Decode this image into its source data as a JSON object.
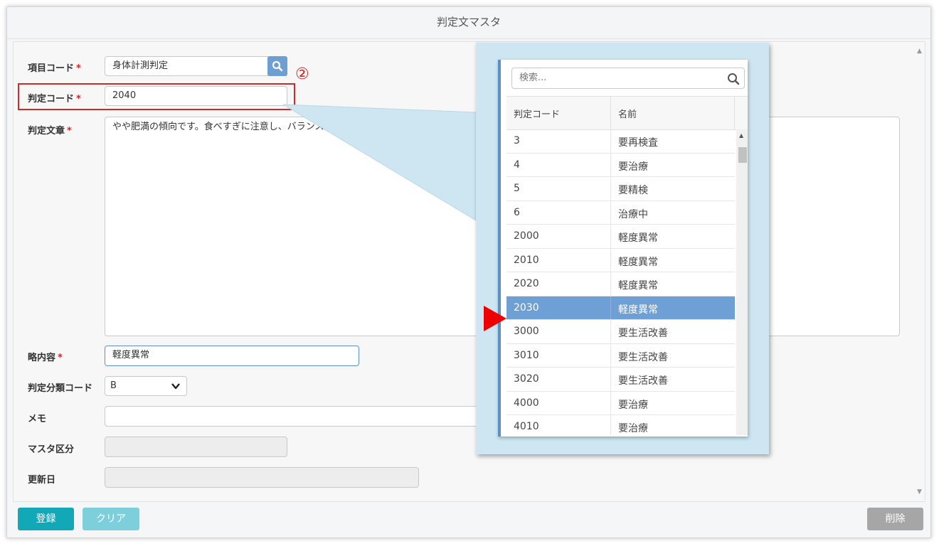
{
  "window": {
    "title": "判定文マスタ"
  },
  "form": {
    "item_code": {
      "label": "項目コード",
      "required_mark": "*",
      "value": "身体計測判定"
    },
    "judge_code": {
      "label": "判定コード",
      "required_mark": "*",
      "value": "2040"
    },
    "judge_text": {
      "label": "判定文章",
      "required_mark": "*",
      "value": "やや肥満の傾向です。食べすぎに注意し、バランス"
    },
    "short_content": {
      "label": "略内容",
      "required_mark": "*",
      "value": "軽度異常"
    },
    "category_code": {
      "label": "判定分類コード",
      "selected": "B"
    },
    "memo": {
      "label": "メモ",
      "value": ""
    },
    "master_type": {
      "label": "マスタ区分",
      "value": ""
    },
    "updated_date": {
      "label": "更新日",
      "value": ""
    }
  },
  "annotation": {
    "step_number": "②"
  },
  "buttons": {
    "register": "登録",
    "clear": "クリア",
    "delete": "削除"
  },
  "colors": {
    "register_button": "#13a8b8",
    "clear_button": "#7ecfdc",
    "delete_button": "#a6a6a6",
    "selected_row": "#6e9fd5",
    "highlight_border": "#cc2b2b",
    "callout_bg": "#cde6f2",
    "arrow": "#ee0000"
  },
  "dropdown": {
    "search_placeholder": "検索...",
    "columns": [
      "判定コード",
      "名前"
    ],
    "rows": [
      {
        "code": "3",
        "name": "要再検査"
      },
      {
        "code": "4",
        "name": "要治療"
      },
      {
        "code": "5",
        "name": "要精検"
      },
      {
        "code": "6",
        "name": "治療中"
      },
      {
        "code": "2000",
        "name": "軽度異常"
      },
      {
        "code": "2010",
        "name": "軽度異常"
      },
      {
        "code": "2020",
        "name": "軽度異常"
      },
      {
        "code": "2030",
        "name": "軽度異常"
      },
      {
        "code": "3000",
        "name": "要生活改善"
      },
      {
        "code": "3010",
        "name": "要生活改善"
      },
      {
        "code": "3020",
        "name": "要生活改善"
      },
      {
        "code": "4000",
        "name": "要治療"
      },
      {
        "code": "4010",
        "name": "要治療"
      }
    ],
    "selected_code": "2030"
  }
}
